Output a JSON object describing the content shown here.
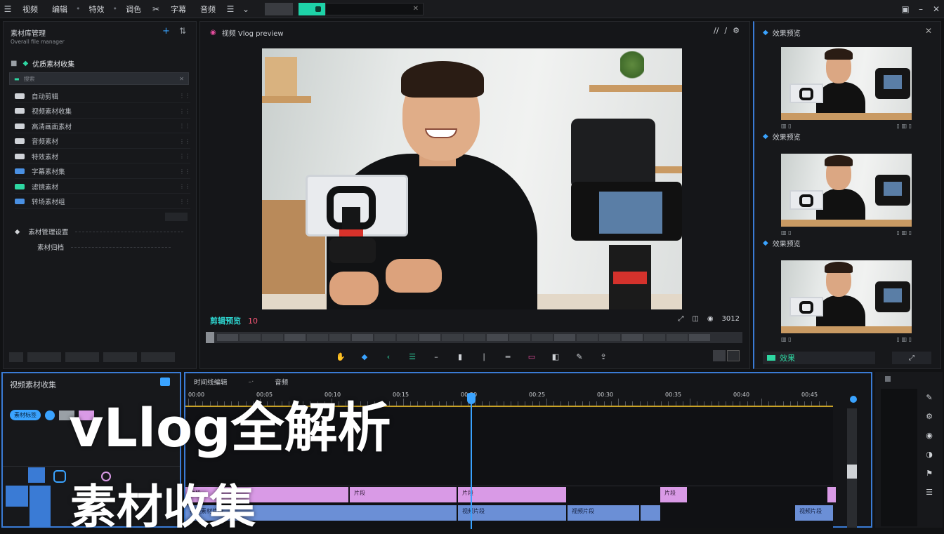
{
  "topbar": {
    "menu": [
      "视频",
      "编辑",
      "特效",
      "调色",
      "字幕",
      "音频"
    ],
    "icons": [
      "menu-icon",
      "list-icon",
      "chevron-down-icon",
      "layout-icon",
      "settings-icon",
      "minimize-icon",
      "close-icon"
    ]
  },
  "left_panel": {
    "title": "素材库管理",
    "subtitle": "Overall file manager",
    "section": "优质素材收集",
    "search_placeholder": "搜索",
    "items": [
      {
        "label": "自动剪辑",
        "color": "#d0d3d8"
      },
      {
        "label": "视频素材收集",
        "color": "#d0d3d8"
      },
      {
        "label": "高清画面素材",
        "color": "#d0d3d8"
      },
      {
        "label": "音频素材",
        "color": "#d0d3d8"
      },
      {
        "label": "特效素材",
        "color": "#d0d3d8"
      },
      {
        "label": "字幕素材集",
        "color": "#4a90e2"
      },
      {
        "label": "滤镜素材",
        "color": "#2ed7a2"
      },
      {
        "label": "转场素材组",
        "color": "#4a90e2"
      }
    ],
    "extra_1": "素材管理设置",
    "extra_2": "素材归档"
  },
  "preview": {
    "title": "视频 Vlog preview",
    "label": "剪辑预览",
    "label_num": "10",
    "timecode": "3012",
    "tools": [
      "pen-icon",
      "slash-icon",
      "settings-icon"
    ]
  },
  "right_panel": {
    "title": "效果预览",
    "thumb_labels": [
      "效果预览",
      "效果预览",
      "效果预览"
    ],
    "bottom_button": "效果"
  },
  "bottom_left": {
    "title": "视频素材收集",
    "tag": "素材标签"
  },
  "timeline": {
    "tab1": "时间线编辑",
    "tab2": "音频",
    "ruler": [
      "00:00",
      "00:05",
      "00:10",
      "00:15",
      "00:20",
      "00:25",
      "00:30",
      "00:35",
      "00:40",
      "00:45"
    ],
    "track1": [
      "片段",
      "片段",
      "片段",
      "片段"
    ],
    "track2": [
      "视频素材片段",
      "视频片段",
      "视频片段",
      "视频片段"
    ]
  },
  "overlay": {
    "line1": "vLlog全解析",
    "line2": "素材收集"
  }
}
